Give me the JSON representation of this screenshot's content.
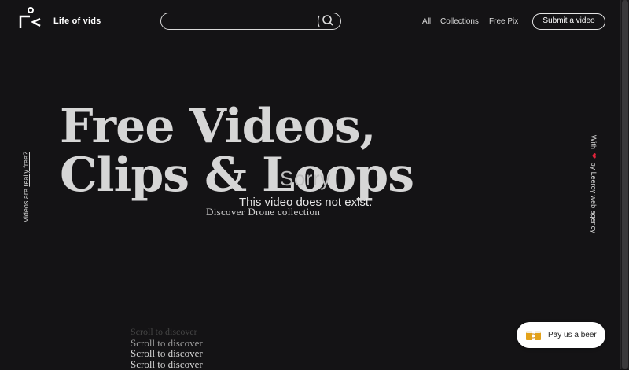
{
  "header": {
    "logo_text": "Life of vids",
    "search": {
      "placeholder": ""
    },
    "nav": {
      "all": "All",
      "collections": "Collections",
      "free_pix": "Free Pix"
    },
    "submit_label": "Submit a video"
  },
  "hero": {
    "line1": "Free Videos,",
    "line2": "Clips & Loops"
  },
  "error": {
    "title": "Sorry",
    "message": "This video does not exist."
  },
  "discover": {
    "prefix": "Discover",
    "link": "Drone collection"
  },
  "side_left": {
    "prefix": "Videos are ",
    "link": "really free?"
  },
  "side_right": {
    "prefix": "With",
    "middle": "by Leeroy",
    "link": "web agency"
  },
  "scroll": [
    "Scroll to discover",
    "Scroll to discover",
    "Scroll to discover",
    "Scroll to discover"
  ],
  "beer_button": {
    "label": "Pay us a beer"
  },
  "colors": {
    "background": "#141315",
    "heart": "#e0233a"
  }
}
